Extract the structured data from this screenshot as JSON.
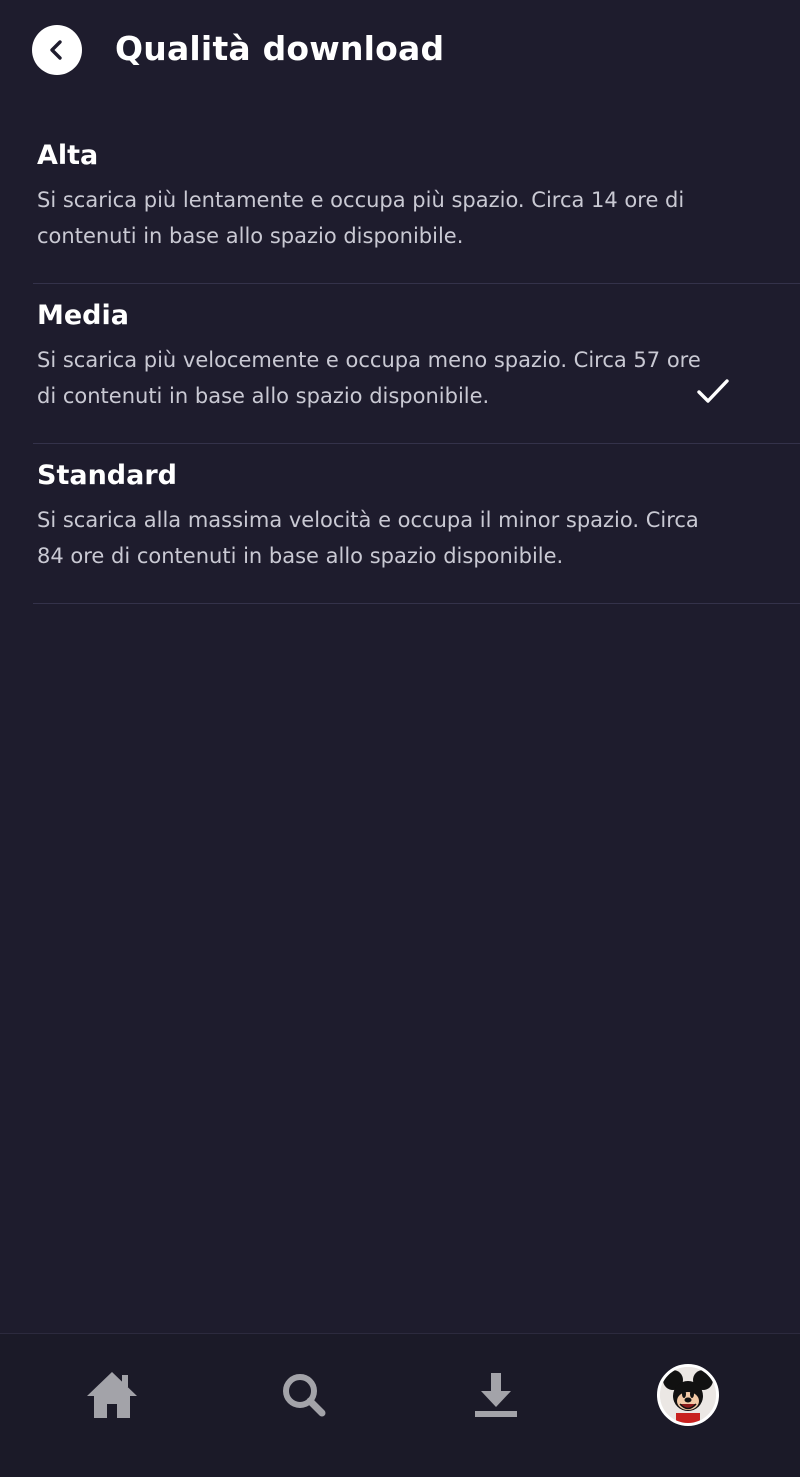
{
  "header": {
    "title": "Qualità download"
  },
  "options": [
    {
      "title": "Alta",
      "description": "Si scarica più lentamente e occupa più spazio. Circa 14 ore di contenuti in base allo spazio disponibile.",
      "selected": false
    },
    {
      "title": "Media",
      "description": "Si scarica più velocemente e occupa meno spazio. Circa 57 ore di contenuti in base allo spazio disponibile.",
      "selected": false
    },
    {
      "title": "Standard",
      "description": "Si scarica alla massima velocità e occupa il minor spazio. Circa 84 ore di contenuti in base allo spazio disponibile.",
      "selected": true
    }
  ],
  "tabbar": {
    "items": [
      {
        "icon": "home-icon"
      },
      {
        "icon": "search-icon"
      },
      {
        "icon": "download-icon"
      },
      {
        "icon": "profile-avatar"
      }
    ]
  },
  "colors": {
    "background": "#1e1c2d",
    "divider": "#34324a",
    "text_primary": "#ffffff",
    "text_secondary": "#c9c9d3",
    "tab_icon": "#a3a3a9"
  }
}
